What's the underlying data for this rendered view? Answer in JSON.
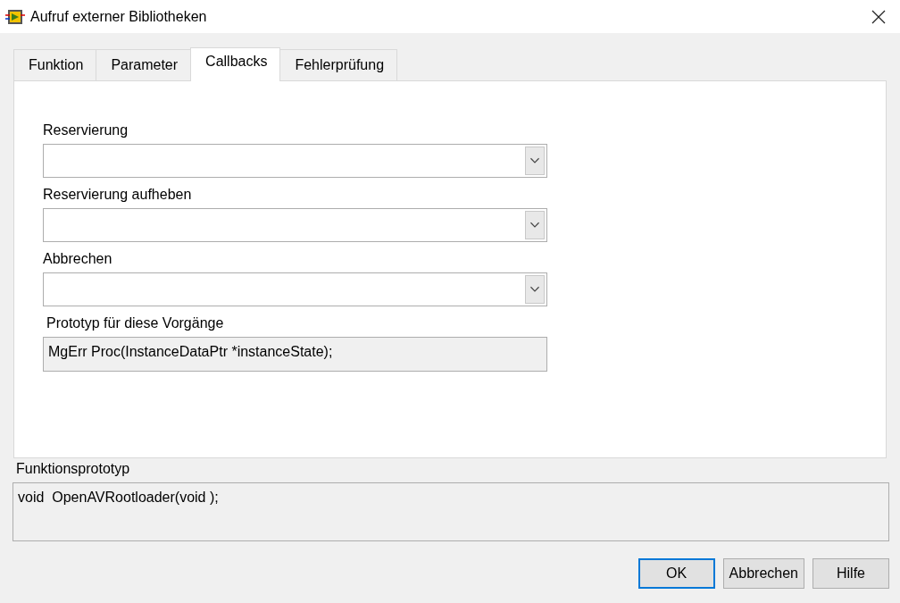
{
  "window": {
    "title": "Aufruf externer Bibliotheken"
  },
  "tabs": [
    {
      "label": "Funktion",
      "selected": false
    },
    {
      "label": "Parameter",
      "selected": false
    },
    {
      "label": "Callbacks",
      "selected": true
    },
    {
      "label": "Fehlerprüfung",
      "selected": false
    }
  ],
  "callbacks": [
    {
      "label": "Reservierung"
    },
    {
      "label": "Reservierung aufheben"
    },
    {
      "label": "Abbrechen"
    }
  ],
  "prototype": {
    "label": "Prototyp für diese Vorgänge",
    "value": "MgErr Proc(InstanceDataPtr *instanceState);"
  },
  "function_prototype": {
    "label": "Funktionsprototyp",
    "value": "void  OpenAVRootloader(void );"
  },
  "buttons": [
    {
      "label": "OK",
      "default": true
    },
    {
      "label": "Abbrechen",
      "default": false
    },
    {
      "label": "Hilfe",
      "default": false
    }
  ]
}
